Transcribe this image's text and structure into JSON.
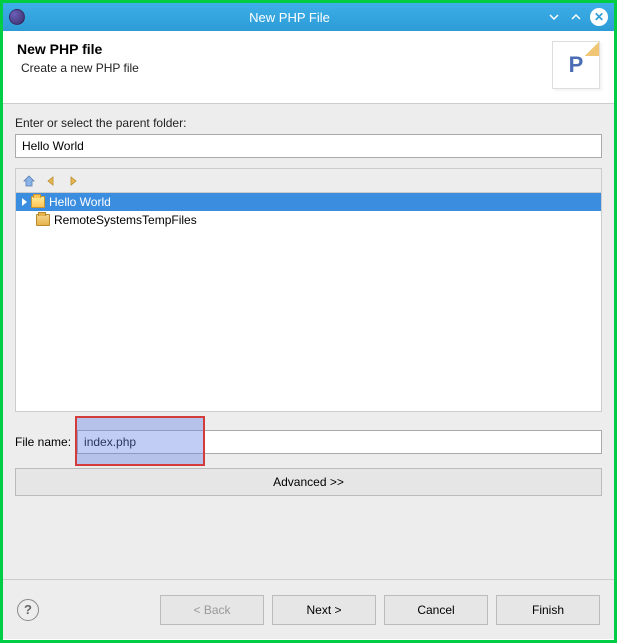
{
  "window": {
    "title": "New PHP File"
  },
  "header": {
    "title": "New PHP file",
    "subtitle": "Create a new PHP file"
  },
  "parent_folder": {
    "label": "Enter or select the parent folder:",
    "value": "Hello World"
  },
  "tree": {
    "items": [
      {
        "label": "Hello World",
        "selected": true,
        "expandable": true
      },
      {
        "label": "RemoteSystemsTempFiles",
        "selected": false,
        "expandable": false
      }
    ]
  },
  "filename": {
    "label": "File name:",
    "value": "index.php"
  },
  "advanced": {
    "label": "Advanced >>"
  },
  "buttons": {
    "back": "< Back",
    "next": "Next >",
    "cancel": "Cancel",
    "finish": "Finish"
  },
  "icons": {
    "home": "home-icon",
    "back": "back-arrow-icon",
    "forward": "forward-arrow-icon"
  }
}
